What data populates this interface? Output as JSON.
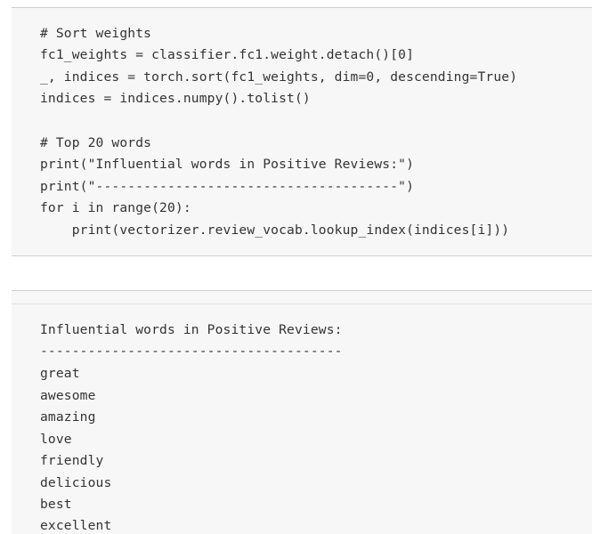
{
  "code_cell": {
    "lines": [
      "# Sort weights",
      "fc1_weights = classifier.fc1.weight.detach()[0]",
      "_, indices = torch.sort(fc1_weights, dim=0, descending=True)",
      "indices = indices.numpy().tolist()",
      "",
      "# Top 20 words",
      "print(\"Influential words in Positive Reviews:\")",
      "print(\"--------------------------------------\")",
      "for i in range(20):",
      "    print(vectorizer.review_vocab.lookup_index(indices[i]))"
    ]
  },
  "output_cell": {
    "title": "Influential words in Positive Reviews:",
    "separator": "--------------------------------------",
    "words": [
      "great",
      "awesome",
      "amazing",
      "love",
      "friendly",
      "delicious",
      "best",
      "excellent"
    ]
  }
}
